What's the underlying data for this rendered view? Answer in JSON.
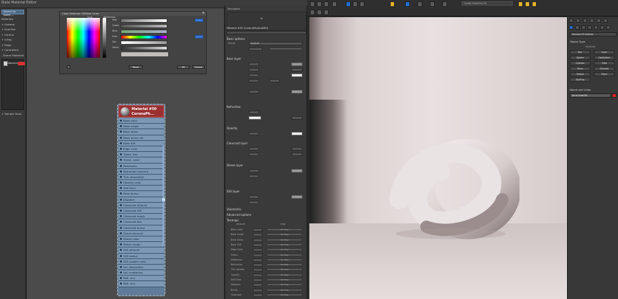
{
  "topbar": {
    "title": "Slate Material Editor"
  },
  "browser": {
    "search": "Search by Name ...",
    "categories": [
      "Materials",
      "+ General",
      "+ Scanline",
      "+ Corona",
      "+ V-Ray",
      "+ Maps",
      "+ Controllers",
      "- Scene Materials"
    ],
    "scene_entry": "Material",
    "sample_slots": "+ Sample Slots"
  },
  "color_picker": {
    "title": "Color Selector: Diffuse Color",
    "hue_label": "Hue",
    "whiteness_label": "Whiteness",
    "channel_labels": [
      "Red",
      "Green",
      "Blue",
      "Hue",
      "Sat",
      "Value"
    ],
    "buttons": [
      "Reset",
      "OK",
      "Cancel"
    ]
  },
  "node": {
    "title_line1": "Material #50",
    "title_line2": "CoronaPh...",
    "pins": [
      "Base color",
      "Base rough",
      "Base aniso.",
      "Base aniso. rot",
      "Base IOR",
      "Edge color",
      "Transl. frac",
      "Transl. color",
      "Metalness",
      "Refraction amount",
      "Thin absorption",
      "Opacity color",
      "Self-illum",
      "Base bump",
      "Displace",
      "Clearcoat amount",
      "Clearcoat IOR",
      "Clearcoat rough",
      "Clearcoat abs",
      "Clearcoat bump",
      "Sheen amount",
      "Sheen color",
      "Sheen rough",
      "SSS amount",
      "SSS radius",
      "SSS scatter color",
      "Vol. absorption",
      "Vol. scattering",
      "Refl. env",
      "Refr. env"
    ]
  },
  "params": {
    "header": "Navigator",
    "material_title": "Material #50 (CoronaPhysicalMtl)",
    "sections": [
      "Basic options",
      "Base layer",
      "Refraction",
      "Opacity",
      "Clearcoat layer",
      "Sheen layer",
      "SSS layer",
      "Volumetric",
      "Advanced options",
      "Maps",
      "Texmaps"
    ],
    "preset_label": "Preset",
    "preset_value": "Default",
    "texmap_rows": [
      "Base color",
      "Base rough",
      "Base aniso.",
      "Base IOR",
      "Edge color",
      "Transl.",
      "Metalness",
      "Refraction",
      "Thin absorb.",
      "Opacity",
      "Self-illum",
      "Displace",
      "Bump",
      "Clearcoat"
    ],
    "amount_label": "amount",
    "map_label": "map",
    "no_map": "No Map"
  },
  "viewport_toolbar": {
    "selection_set": "Create Selection Se"
  },
  "command_panel": {
    "object_type": "Object Type",
    "autogrid": "AutoGrid",
    "buttons": [
      "Box",
      "Cone",
      "Sphere",
      "GeoSphere",
      "Cylinder",
      "Tube",
      "Torus",
      "Pyramid",
      "Teapot",
      "Plane",
      "TextPlus"
    ],
    "name_color": "Name and Color",
    "name_value": "Torus Knot001",
    "dropdown": "Standard Primitives"
  }
}
